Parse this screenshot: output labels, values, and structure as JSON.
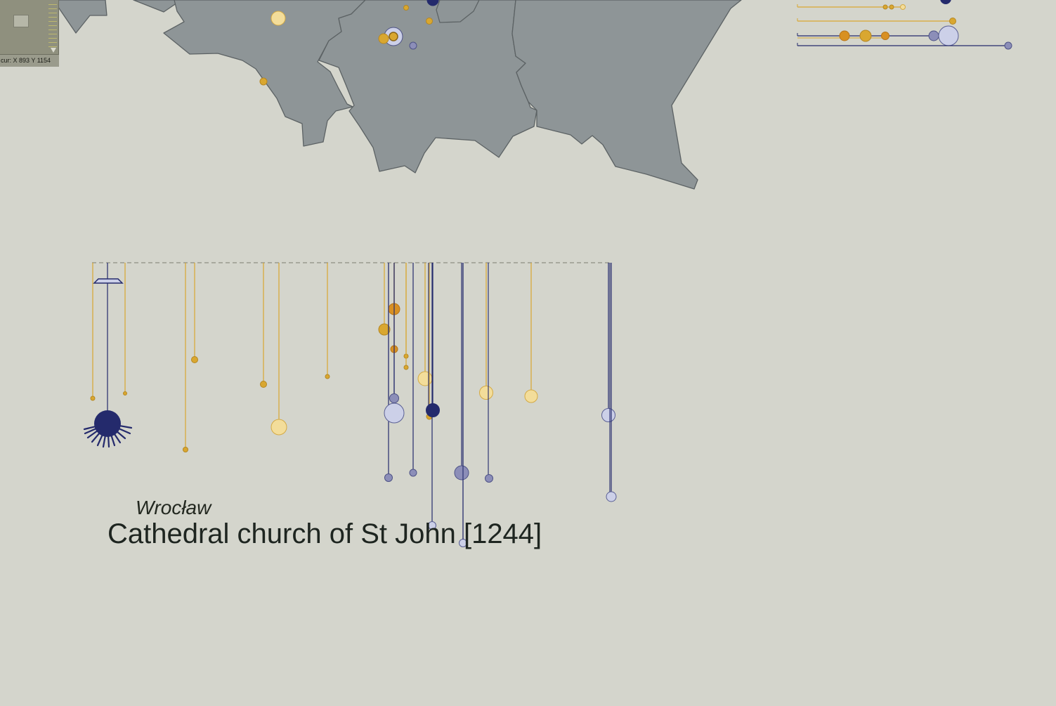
{
  "minimap": {
    "coord_text": "cur: X 893 Y 1154"
  },
  "place": {
    "city": "Wrocław",
    "title": "Cathedral church of St John [1244]"
  },
  "colors": {
    "background": "#d4d5cc",
    "land": "#8e9597",
    "land_border": "#5c6264",
    "gold": "#d9a730",
    "gold_pale": "#f3dd9a",
    "orange": "#d89022",
    "navy": "#242a6c",
    "slate": "#8c8eb8",
    "lavender": "#ccd0e8",
    "timeline_dash": "#7c7d70"
  },
  "map_markers": [
    {
      "kind": "pale"
    },
    {
      "kind": "gold"
    },
    {
      "kind": "gold"
    },
    {
      "kind": "gold"
    },
    {
      "kind": "navy"
    },
    {
      "kind": "ring"
    },
    {
      "kind": "slate"
    },
    {
      "kind": "gold"
    }
  ],
  "legend_rows": [
    {
      "kind": "gold-line-with-dots"
    },
    {
      "kind": "gold-line-with-dot"
    },
    {
      "kind": "mixed-line-with-circles"
    },
    {
      "kind": "navy-line-with-dot"
    }
  ],
  "pendants": [
    {
      "kind": "gold"
    },
    {
      "kind": "anchor"
    },
    {
      "kind": "gold"
    },
    {
      "kind": "gold"
    },
    {
      "kind": "gold"
    },
    {
      "kind": "gold"
    },
    {
      "kind": "pale"
    },
    {
      "kind": "gold"
    },
    {
      "kind": "gold"
    },
    {
      "kind": "slate"
    },
    {
      "kind": "lavender"
    },
    {
      "kind": "orange"
    },
    {
      "kind": "orange"
    },
    {
      "kind": "slate"
    },
    {
      "kind": "gold"
    },
    {
      "kind": "gold"
    },
    {
      "kind": "pale"
    },
    {
      "kind": "gold"
    },
    {
      "kind": "navy"
    },
    {
      "kind": "lavender"
    },
    {
      "kind": "slate"
    },
    {
      "kind": "lavender"
    },
    {
      "kind": "pale"
    },
    {
      "kind": "slate"
    },
    {
      "kind": "pale"
    },
    {
      "kind": "lavender"
    },
    {
      "kind": "lavender"
    }
  ]
}
